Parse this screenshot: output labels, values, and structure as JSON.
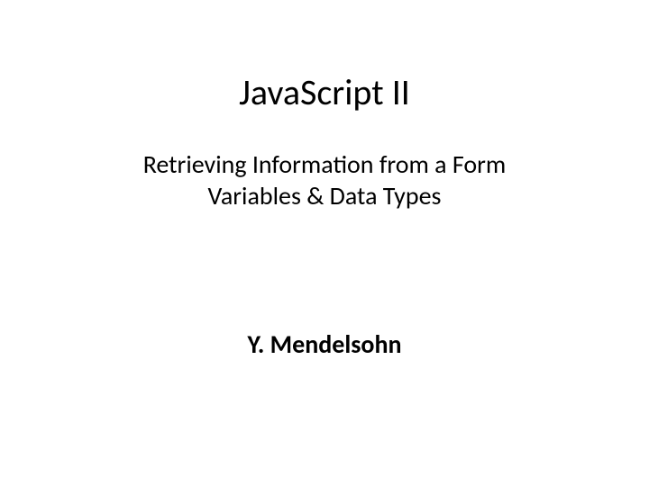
{
  "slide": {
    "title": "JavaScript II",
    "subtitle_line1": "Retrieving Information from a Form",
    "subtitle_line2": "Variables & Data Types",
    "author": "Y. Mendelsohn"
  }
}
